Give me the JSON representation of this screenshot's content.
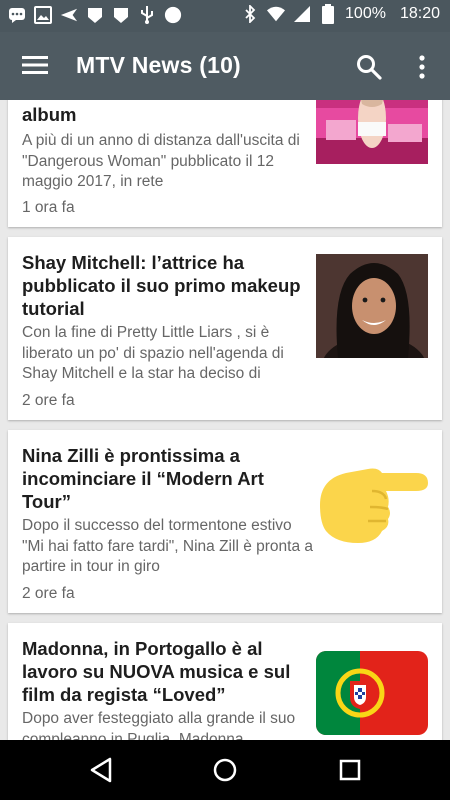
{
  "status_bar": {
    "battery": "100%",
    "time": "18:20",
    "icons": [
      "chat-icon",
      "image-icon",
      "send-icon",
      "shield-icon",
      "shield-icon",
      "usb-icon",
      "circle-icon",
      "bluetooth-icon",
      "wifi-icon",
      "signal-icon",
      "battery-icon"
    ]
  },
  "app_bar": {
    "title": "MTV News (10)",
    "icons": [
      "menu-icon",
      "search-icon",
      "more-vert-icon"
    ]
  },
  "articles": [
    {
      "title_tail": "album",
      "excerpt": "A più di un anno di distanza dall'uscita di \"Dangerous Woman\" pubblicato il 12 maggio 2017, in rete",
      "time": "1 ora fa"
    },
    {
      "title": "Shay Mitchell: l’attrice ha pubblicato il suo primo makeup tutorial",
      "excerpt": "Con la fine di Pretty Little Liars , si è liberato un po' di spazio nell'agenda di Shay Mitchell e la star ha deciso di",
      "time": "2 ore fa"
    },
    {
      "title": "Nina Zilli è prontissima a incominciare il “Modern Art Tour”",
      "excerpt": "Dopo il successo del tormentone estivo \"Mi hai fatto fare tardi\",  Nina Zill   è pronta a partire in tour in giro",
      "time": "2 ore fa"
    },
    {
      "title": "Madonna, in Portogallo è al lavoro su NUOVA musica e sul film da regista “Loved”",
      "excerpt": "Dopo aver festeggiato alla grande il suo compleanno in Puglia, Madonna"
    }
  ],
  "colors": {
    "status_bar": "#4b575e",
    "app_bar": "#4f5b62",
    "background": "#e9e9e9",
    "card": "#ffffff",
    "text_title": "#1e1e1e",
    "text_muted": "#666666"
  }
}
